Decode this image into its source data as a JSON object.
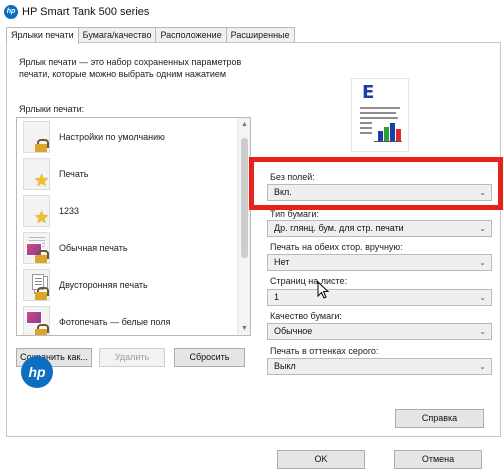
{
  "window": {
    "title": "HP Smart Tank 500 series",
    "logo_text": "hp"
  },
  "tabs": [
    {
      "label": "Ярлыки печати",
      "active": true
    },
    {
      "label": "Бумага/качество",
      "active": false
    },
    {
      "label": "Расположение",
      "active": false
    },
    {
      "label": "Расширенные",
      "active": false
    }
  ],
  "shortcuts": {
    "description": "Ярлык печати — это набор сохраненных параметров печати, которые можно выбрать одним нажатием",
    "list_label": "Ярлыки печати:",
    "items": [
      {
        "label": "Настройки по умолчанию",
        "icon": "lock-icon"
      },
      {
        "label": "Печать",
        "icon": "star-icon"
      },
      {
        "label": "1233",
        "icon": "star-icon"
      },
      {
        "label": "Обычная печать",
        "icon": "lock-icon"
      },
      {
        "label": "Двусторонняя печать",
        "icon": "lock-icon"
      },
      {
        "label": "Фотопечать — белые поля",
        "icon": "lock-icon"
      }
    ],
    "buttons": {
      "save": "Сохранить как...",
      "delete": "Удалить",
      "reset": "Сбросить"
    }
  },
  "settings": [
    {
      "label": "Без полей:",
      "value": "Вкл."
    },
    {
      "label": "Тип бумаги:",
      "value": "Др. глянц. бум. для стр. печати"
    },
    {
      "label": "Печать на обеих стор. вручную:",
      "value": "Нет"
    },
    {
      "label": "Страниц на листе:",
      "value": "1"
    },
    {
      "label": "Качество бумаги:",
      "value": "Обычное"
    },
    {
      "label": "Печать в оттенках серого:",
      "value": "Выкл"
    }
  ],
  "buttons": {
    "help": "Справка",
    "ok": "OK",
    "cancel": "Отмена"
  },
  "preview": {
    "letter": "E",
    "bar_colors": [
      "#1b3fa8",
      "#2e9e3a",
      "#1b3fa8",
      "#d92b2b"
    ]
  },
  "colors": {
    "highlight": "#e8211b",
    "hp_blue": "#0b6ec0"
  }
}
